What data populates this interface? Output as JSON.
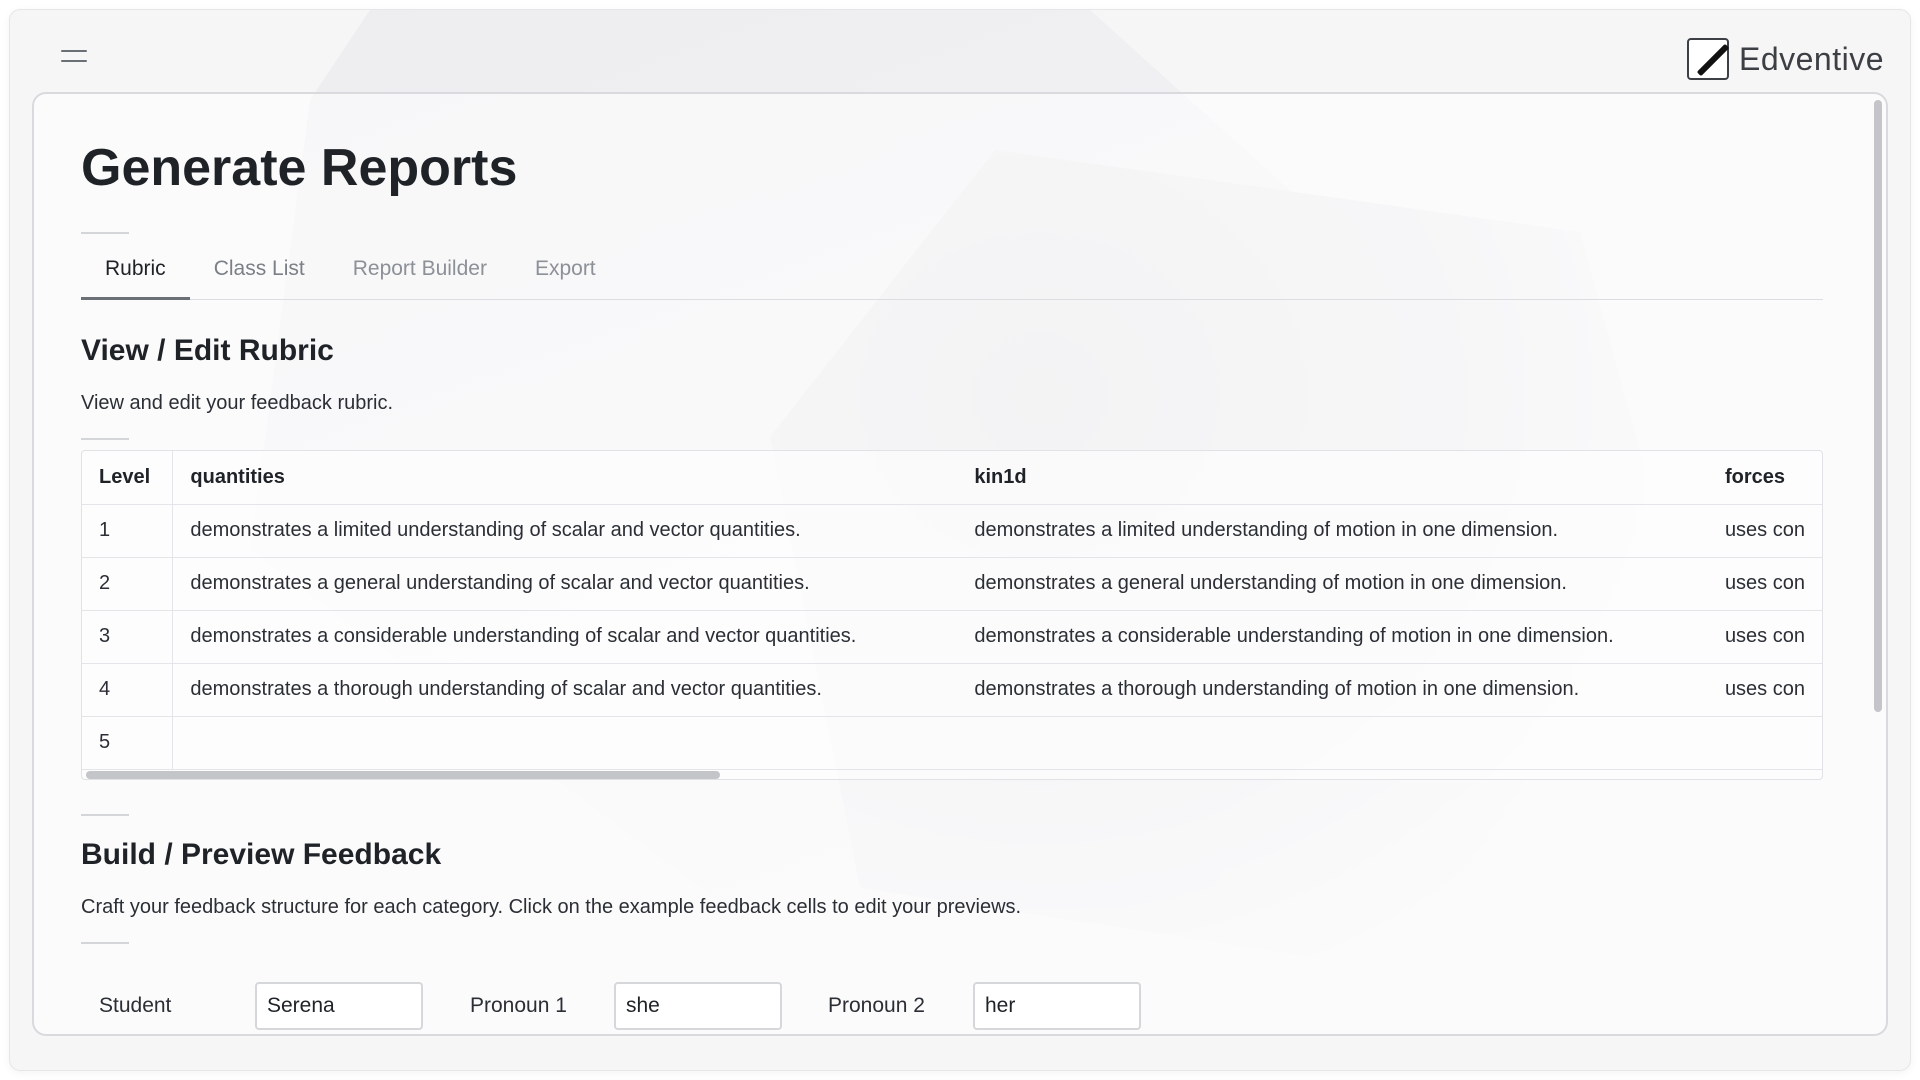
{
  "brand": {
    "name": "Edventive",
    "logo_icon": "pencil-logo-icon"
  },
  "page": {
    "title": "Generate Reports"
  },
  "tabs": [
    {
      "label": "Rubric",
      "active": true
    },
    {
      "label": "Class List",
      "active": false
    },
    {
      "label": "Report Builder",
      "active": false
    },
    {
      "label": "Export",
      "active": false
    }
  ],
  "rubric": {
    "title": "View / Edit Rubric",
    "description": "View and edit your feedback rubric.",
    "columns": [
      "Level",
      "quantities",
      "kin1d",
      "forces"
    ],
    "rows": [
      {
        "level": "1",
        "quantities": "demonstrates a limited understanding of scalar and vector quantities.",
        "kin1d": "demonstrates a limited understanding of motion in one dimension.",
        "forces": "uses con"
      },
      {
        "level": "2",
        "quantities": "demonstrates a general understanding of scalar and vector quantities.",
        "kin1d": "demonstrates a general understanding of motion in one dimension.",
        "forces": "uses con"
      },
      {
        "level": "3",
        "quantities": "demonstrates a considerable understanding of scalar and vector quantities.",
        "kin1d": "demonstrates a considerable understanding of motion in one dimension.",
        "forces": "uses con"
      },
      {
        "level": "4",
        "quantities": "demonstrates a thorough understanding of scalar and vector quantities.",
        "kin1d": "demonstrates a thorough understanding of motion in one dimension.",
        "forces": "uses con"
      },
      {
        "level": "5",
        "quantities": "",
        "kin1d": "",
        "forces": ""
      }
    ]
  },
  "feedback": {
    "title": "Build / Preview Feedback",
    "description": "Craft your feedback structure for each category. Click on the example feedback cells to edit your previews.",
    "fields": [
      {
        "label": "Student",
        "value": "Serena"
      },
      {
        "label": "Pronoun 1",
        "value": "she"
      },
      {
        "label": "Pronoun 2",
        "value": "her"
      }
    ]
  }
}
